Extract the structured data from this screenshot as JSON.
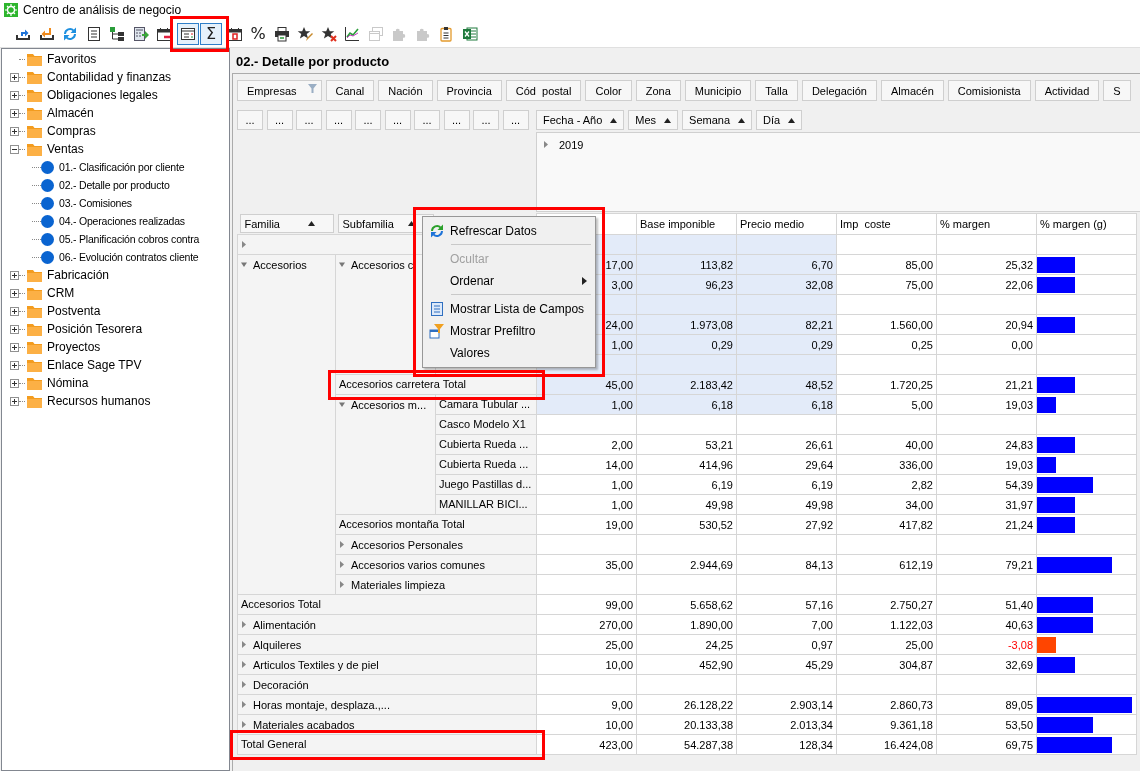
{
  "window": {
    "title": "Centro de análisis de negocio"
  },
  "toolbar": {
    "groups": [
      {
        "highlighted": false,
        "items": [
          {
            "kind": "export",
            "pressed": false,
            "disabled": false
          },
          {
            "kind": "import",
            "pressed": false,
            "disabled": false
          },
          {
            "kind": "refresh",
            "pressed": false,
            "disabled": false
          },
          {
            "kind": "list",
            "pressed": false,
            "disabled": false
          },
          {
            "kind": "tree",
            "pressed": false,
            "disabled": false
          },
          {
            "kind": "calc",
            "pressed": false,
            "disabled": false
          },
          {
            "kind": "calendar",
            "pressed": false,
            "disabled": false
          }
        ]
      },
      {
        "highlighted": true,
        "items": [
          {
            "kind": "fields",
            "pressed": true,
            "disabled": false
          },
          {
            "kind": "glyph",
            "label": "Σ",
            "pressed": true,
            "disabled": false
          }
        ]
      },
      {
        "highlighted": false,
        "items": [
          {
            "kind": "report",
            "pressed": false,
            "disabled": false
          },
          {
            "kind": "glyph",
            "label": "%",
            "pressed": false,
            "disabled": false
          },
          {
            "kind": "print",
            "pressed": false,
            "disabled": false
          },
          {
            "kind": "star_edit",
            "pressed": false,
            "disabled": false
          },
          {
            "kind": "star_remove",
            "pressed": false,
            "disabled": false
          },
          {
            "kind": "chart",
            "pressed": false,
            "disabled": false
          },
          {
            "kind": "windows",
            "pressed": false,
            "disabled": true
          },
          {
            "kind": "puzzle",
            "pressed": false,
            "disabled": true
          },
          {
            "kind": "puzzle",
            "pressed": false,
            "disabled": true
          },
          {
            "kind": "clipboard",
            "pressed": false,
            "disabled": false
          },
          {
            "kind": "excel",
            "pressed": false,
            "disabled": false
          }
        ]
      }
    ]
  },
  "sidebar": {
    "items": [
      {
        "label": "Favoritos",
        "kind": "plain"
      },
      {
        "label": "Contabilidad y finanzas",
        "kind": "group",
        "expanded": false
      },
      {
        "label": "Obligaciones legales",
        "kind": "group",
        "expanded": false
      },
      {
        "label": "Almacén",
        "kind": "group",
        "expanded": false
      },
      {
        "label": "Compras",
        "kind": "group",
        "expanded": false
      },
      {
        "label": "Ventas",
        "kind": "group",
        "expanded": true,
        "children": [
          {
            "label": "01.- Clasificación por cliente"
          },
          {
            "label": "02.- Detalle por producto"
          },
          {
            "label": "03.- Comisiones"
          },
          {
            "label": "04.- Operaciones realizadas"
          },
          {
            "label": "05.- Planificación cobros contra"
          },
          {
            "label": "06.- Evolución contratos cliente"
          }
        ]
      },
      {
        "label": "Fabricación",
        "kind": "group",
        "expanded": false
      },
      {
        "label": "CRM",
        "kind": "group",
        "expanded": false
      },
      {
        "label": "Postventa",
        "kind": "group",
        "expanded": false
      },
      {
        "label": "Posición Tesorera",
        "kind": "group",
        "expanded": false
      },
      {
        "label": "Proyectos",
        "kind": "group",
        "expanded": false
      },
      {
        "label": "Enlace Sage TPV",
        "kind": "group",
        "expanded": false
      },
      {
        "label": "Nómina",
        "kind": "group",
        "expanded": false
      },
      {
        "label": "Recursos humanos",
        "kind": "group",
        "expanded": false
      }
    ]
  },
  "report": {
    "title": "02.- Detalle por producto",
    "filter_fields": [
      {
        "label": "Empresas",
        "filtered": true
      },
      {
        "label": "Canal",
        "filtered": false
      },
      {
        "label": "Nación",
        "filtered": false
      },
      {
        "label": "Provincia",
        "filtered": false
      },
      {
        "label": "Cód  postal",
        "filtered": false
      },
      {
        "label": "Color",
        "filtered": false
      },
      {
        "label": "Zona",
        "filtered": false
      },
      {
        "label": "Municipio",
        "filtered": false
      },
      {
        "label": "Talla",
        "filtered": false
      },
      {
        "label": "Delegación",
        "filtered": false
      },
      {
        "label": "Almacén",
        "filtered": false
      },
      {
        "label": "Comisionista",
        "filtered": false
      },
      {
        "label": "Actividad",
        "filtered": false
      },
      {
        "label": "S",
        "filtered": false
      }
    ],
    "data_fields": [
      {
        "label": "..."
      },
      {
        "label": "..."
      },
      {
        "label": "..."
      },
      {
        "label": "..."
      },
      {
        "label": "..."
      },
      {
        "label": "..."
      },
      {
        "label": "..."
      },
      {
        "label": "..."
      },
      {
        "label": "..."
      },
      {
        "label": "..."
      }
    ],
    "column_fields": [
      {
        "label": "Fecha - Año",
        "ascending": true
      },
      {
        "label": "Mes",
        "ascending": true
      },
      {
        "label": "Semana",
        "ascending": true
      },
      {
        "label": "Día",
        "ascending": true
      }
    ],
    "column_values": [
      {
        "label": "2019",
        "expanded": false
      }
    ],
    "row_fields": [
      {
        "label": "Familia",
        "ascending": true
      },
      {
        "label": "Subfamilia",
        "ascending": true
      }
    ],
    "columns": [
      {
        "label": "Base imponible"
      },
      {
        "label": "Precio medio"
      },
      {
        "label": "Imp  coste"
      },
      {
        "label": "% margen"
      },
      {
        "label": "% margen (g)"
      }
    ],
    "rows": [
      {
        "expanded": false,
        "selected": true
      },
      {
        "label": "Accesorios",
        "expanded": true,
        "children": [
          {
            "label": "Accesorios c",
            "expanded": true,
            "children": [
              {
                "selected": true,
                "values": [
                  "17,00",
                  "113,82",
                  "6,70",
                  "85,00",
                  "25,32"
                ],
                "margin_bar": {
                  "level": 0.38
                },
                "negative": false
              },
              {
                "selected": true,
                "values": [
                  "3,00",
                  "96,23",
                  "32,08",
                  "75,00",
                  "22,06"
                ],
                "margin_bar": {
                  "level": 0.38
                },
                "negative": false
              },
              {
                "selected": true
              },
              {
                "selected": true,
                "values": [
                  "24,00",
                  "1.973,08",
                  "82,21",
                  "1.560,00",
                  "20,94"
                ],
                "margin_bar": {
                  "level": 0.38
                },
                "negative": false
              },
              {
                "selected": true,
                "values": [
                  "1,00",
                  "0,29",
                  "0,29",
                  "0,25",
                  "0,00"
                ],
                "negative": false
              },
              {
                "selected": true
              }
            ],
            "total": {
              "label": "Accesorios carretera Total",
              "selected": true,
              "highlighted": true,
              "values": [
                "45,00",
                "2.183,42",
                "48,52",
                "1.720,25",
                "21,21"
              ],
              "margin_bar": {
                "level": 0.38
              },
              "negative": false
            }
          },
          {
            "label": "Accesorios m...",
            "expanded": true,
            "children": [
              {
                "label": "Camara Tubular ...",
                "selected": true,
                "values": [
                  "1,00",
                  "6,18",
                  "6,18",
                  "5,00",
                  "19,03"
                ],
                "margin_bar": {
                  "level": 0.19
                },
                "negative": false
              },
              {
                "label": "Casco Modelo X1",
                "selected": false
              },
              {
                "label": "Cubierta Rueda ...",
                "selected": false,
                "values": [
                  "2,00",
                  "53,21",
                  "26,61",
                  "40,00",
                  "24,83"
                ],
                "margin_bar": {
                  "level": 0.38
                },
                "negative": false
              },
              {
                "label": "Cubierta Rueda ...",
                "selected": false,
                "values": [
                  "14,00",
                  "414,96",
                  "29,64",
                  "336,00",
                  "19,03"
                ],
                "margin_bar": {
                  "level": 0.19
                },
                "negative": false
              },
              {
                "label": "Juego Pastillas d...",
                "selected": false,
                "values": [
                  "1,00",
                  "6,19",
                  "6,19",
                  "2,82",
                  "54,39"
                ],
                "margin_bar": {
                  "level": 0.57
                },
                "negative": false
              },
              {
                "label": "MANILLAR BICI...",
                "selected": false,
                "values": [
                  "1,00",
                  "49,98",
                  "49,98",
                  "34,00",
                  "31,97"
                ],
                "margin_bar": {
                  "level": 0.38
                },
                "negative": false
              }
            ],
            "total": {
              "label": "Accesorios montaña Total",
              "selected": false,
              "values": [
                "19,00",
                "530,52",
                "27,92",
                "417,82",
                "21,24"
              ],
              "margin_bar": {
                "level": 0.38
              },
              "negative": false
            }
          },
          {
            "label": "Accesorios Personales",
            "expanded": false,
            "selected": false
          },
          {
            "label": "Accesorios varios comunes",
            "expanded": false,
            "selected": false,
            "values": [
              "35,00",
              "2.944,69",
              "84,13",
              "612,19",
              "79,21"
            ],
            "margin_bar": {
              "level": 0.76
            },
            "negative": false
          },
          {
            "label": "Materiales limpieza",
            "expanded": false,
            "selected": false
          }
        ],
        "total": {
          "label": "Accesorios Total",
          "selected": false,
          "values": [
            "99,00",
            "5.658,62",
            "57,16",
            "2.750,27",
            "51,40"
          ],
          "margin_bar": {
            "level": 0.57
          },
          "negative": false
        }
      },
      {
        "label": "Alimentación",
        "expanded": false,
        "selected": false,
        "values": [
          "270,00",
          "1.890,00",
          "7,00",
          "1.122,03",
          "40,63"
        ],
        "margin_bar": {
          "level": 0.57
        },
        "negative": false
      },
      {
        "label": "Alquileres",
        "expanded": false,
        "selected": false,
        "values": [
          "25,00",
          "24,25",
          "0,97",
          "25,00",
          "-3,08"
        ],
        "margin_bar": {
          "level": 0.19
        },
        "negative": true
      },
      {
        "label": "Articulos Textiles y de piel",
        "expanded": false,
        "selected": false,
        "values": [
          "10,00",
          "452,90",
          "45,29",
          "304,87",
          "32,69"
        ],
        "margin_bar": {
          "level": 0.38
        },
        "negative": false
      },
      {
        "label": "Decoración",
        "expanded": false,
        "selected": false
      },
      {
        "label": "Horas montaje, desplaza.,...",
        "expanded": false,
        "selected": false,
        "values": [
          "9,00",
          "26.128,22",
          "2.903,14",
          "2.860,73",
          "89,05"
        ],
        "margin_bar": {
          "level": 0.96
        },
        "negative": false
      },
      {
        "label": "Materiales acabados",
        "expanded": false,
        "selected": false,
        "values": [
          "10,00",
          "20.133,38",
          "2.013,34",
          "9.361,18",
          "53,50"
        ],
        "margin_bar": {
          "level": 0.57
        },
        "negative": false
      }
    ],
    "grand_total": {
      "label": "Total General",
      "selected": false,
      "highlighted": true,
      "values": [
        "423,00",
        "54.287,38",
        "128,34",
        "16.424,08",
        "69,75"
      ],
      "margin_bar": {
        "level": 0.76
      },
      "negative": false
    }
  },
  "context_menu": {
    "highlighted": true,
    "items": [
      {
        "kind": "refresh",
        "label": "Refrescar Datos",
        "disabled": false,
        "submenu": false
      },
      {
        "kind": "separator"
      },
      {
        "kind": "plain",
        "label": "Ocultar",
        "disabled": true,
        "submenu": false
      },
      {
        "kind": "plain",
        "label": "Ordenar",
        "disabled": false,
        "submenu": true
      },
      {
        "kind": "separator"
      },
      {
        "kind": "fieldlist",
        "label": "Mostrar Lista de Campos",
        "disabled": false,
        "submenu": false
      },
      {
        "kind": "prefilter",
        "label": "Mostrar Prefiltro",
        "disabled": false,
        "submenu": false
      },
      {
        "kind": "plain",
        "label": "Valores",
        "disabled": false,
        "submenu": false
      }
    ]
  }
}
